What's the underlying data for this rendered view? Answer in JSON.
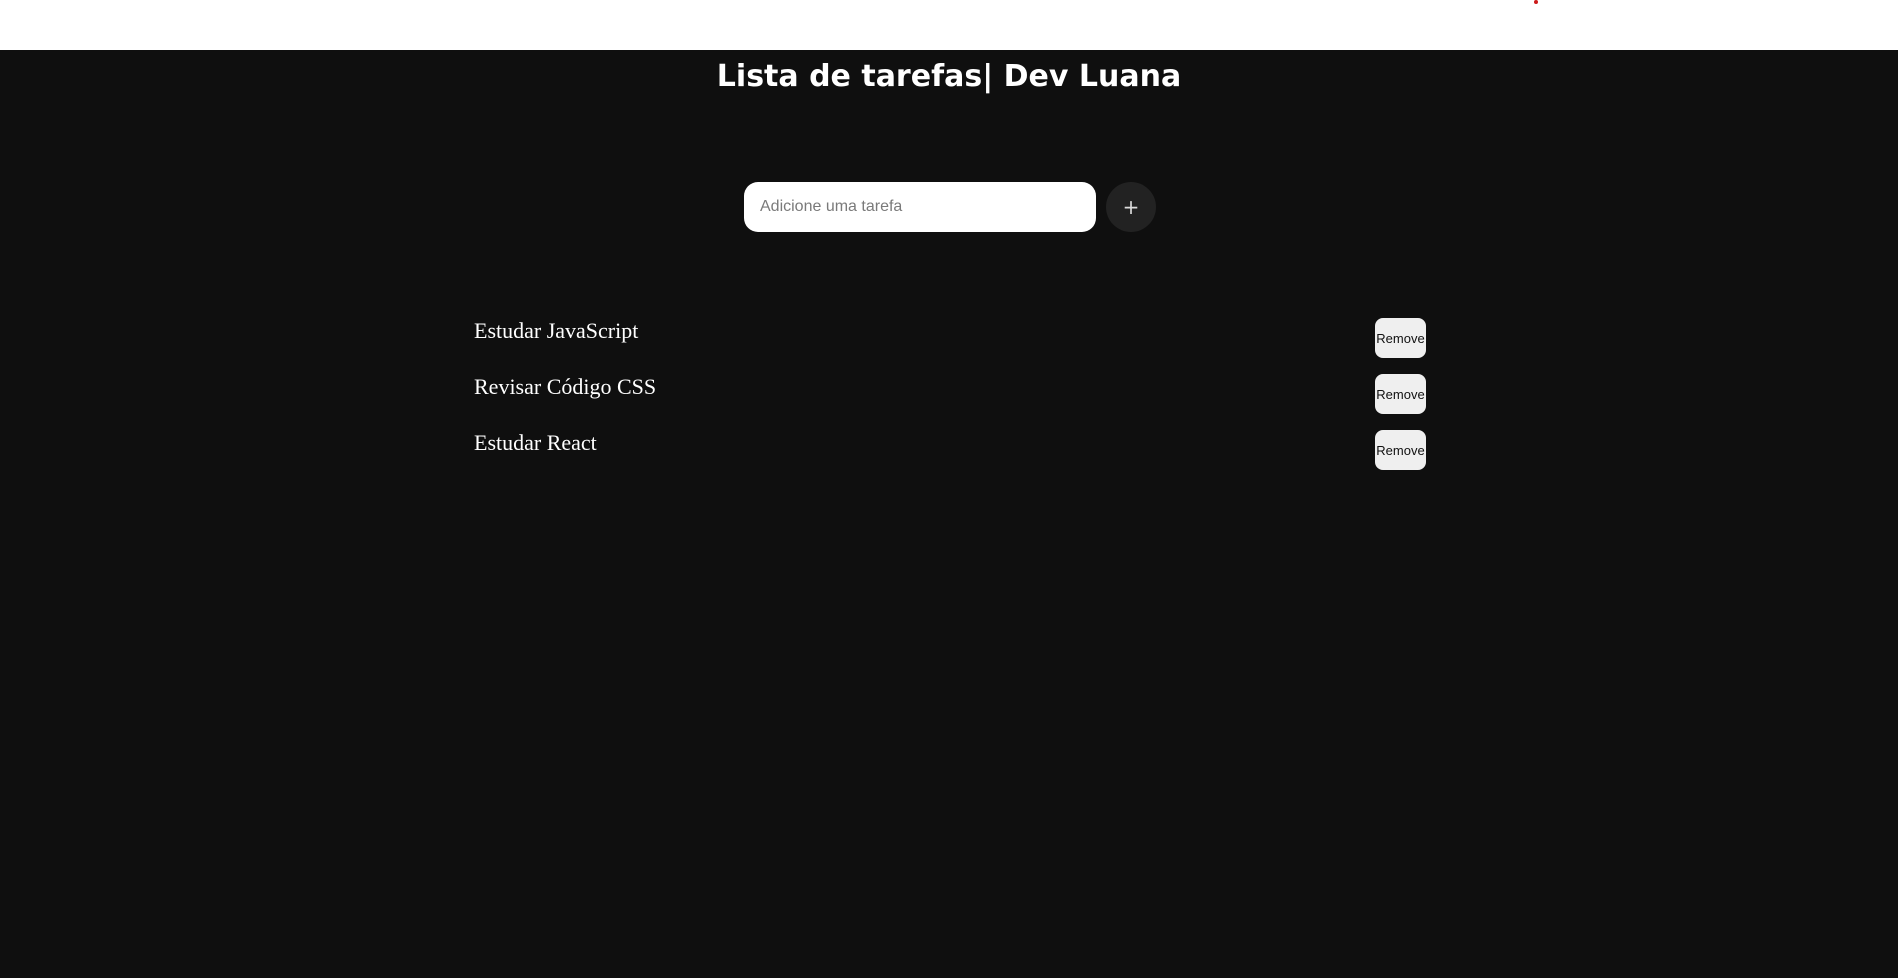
{
  "header": {
    "title": "Lista de tarefas| Dev Luana"
  },
  "add_task": {
    "placeholder": "Adicione uma tarefa",
    "value": "",
    "button_label": "+",
    "button_icon": "plus-icon"
  },
  "tasks": [
    {
      "text": "Estudar JavaScript",
      "remove_label": "Remove"
    },
    {
      "text": "Revisar Código CSS",
      "remove_label": "Remove"
    },
    {
      "text": "Estudar React",
      "remove_label": "Remove"
    }
  ],
  "colors": {
    "background": "#0f0f0f",
    "top_bar": "#ffffff",
    "top_dot": "#cc1a1a",
    "text": "#ffffff",
    "add_button_bg": "#222222",
    "remove_button_bg": "#efefef"
  }
}
